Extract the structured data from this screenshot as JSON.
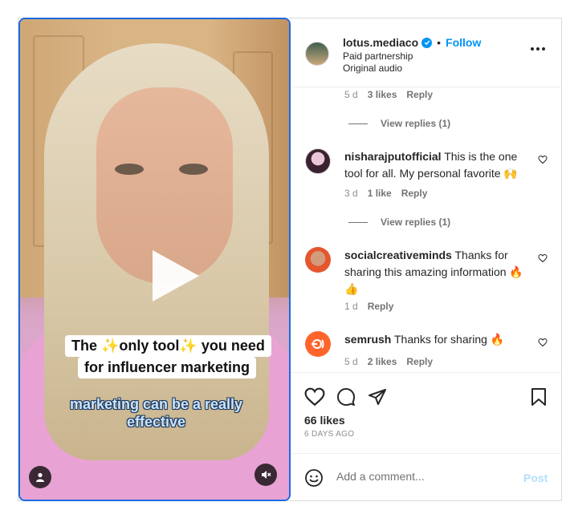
{
  "video": {
    "caption_line1": "The ✨only tool✨ you need",
    "caption_line2": "for influencer marketing",
    "subtitle_line1": "marketing can be a really",
    "subtitle_line2": "effective",
    "icons": {
      "play": "play-icon",
      "user": "user-icon",
      "mute": "speaker-muted-icon"
    }
  },
  "header": {
    "username": "lotus.mediaco",
    "verified": true,
    "separator": "•",
    "follow_label": "Follow",
    "line1": "Paid partnership",
    "line2": "Original audio"
  },
  "comments": {
    "top_partial": {
      "age": "5 d",
      "likes": "3 likes",
      "reply": "Reply",
      "view_replies": "View replies (1)"
    },
    "items": [
      {
        "username": "nisharajputofficial",
        "text": "This is the one tool for all. My personal favorite 🙌",
        "age": "3 d",
        "likes": "1 like",
        "reply": "Reply",
        "view_replies": "View replies (1)"
      },
      {
        "username": "socialcreativeminds",
        "text": "Thanks for sharing this amazing information 🔥👍",
        "age": "1 d",
        "reply": "Reply"
      },
      {
        "username": "semrush",
        "text": "Thanks for sharing 🔥",
        "age": "5 d",
        "likes": "2 likes",
        "reply": "Reply"
      }
    ]
  },
  "actions": {
    "likes": "66 likes",
    "date": "6 DAYS AGO"
  },
  "comment_box": {
    "placeholder": "Add a comment...",
    "post_label": "Post"
  },
  "colors": {
    "accent": "#0095f6",
    "video_border": "#1d6ae0",
    "post_disabled": "#b2dffc"
  }
}
